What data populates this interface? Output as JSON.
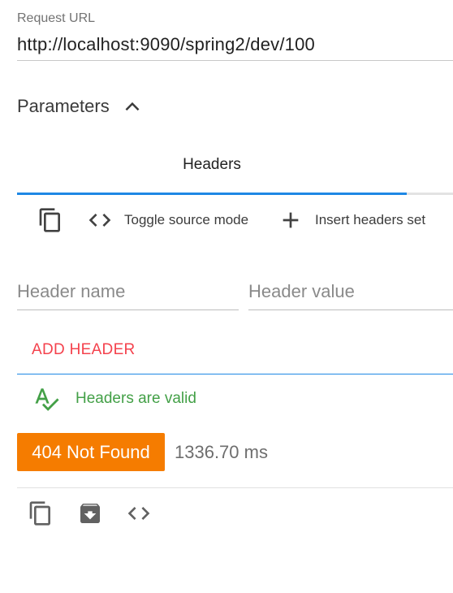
{
  "request": {
    "url_label": "Request URL",
    "url_value": "http://localhost:9090/spring2/dev/100"
  },
  "parameters": {
    "label": "Parameters",
    "icon": "chevron-up-icon"
  },
  "tabs": [
    {
      "label": "Headers",
      "selected": true
    }
  ],
  "toolbar": {
    "copy_icon": "copy-icon",
    "toggle_source_label": "Toggle source mode",
    "toggle_source_icon": "code-icon",
    "insert_set_label": "Insert headers set",
    "insert_set_icon": "plus-icon"
  },
  "headers_form": {
    "name_placeholder": "Header name",
    "value_placeholder": "Header value",
    "name_value": "",
    "value_value": "",
    "add_label": "ADD HEADER"
  },
  "validation": {
    "icon": "spellcheck-icon",
    "text": "Headers are valid"
  },
  "response": {
    "status_text": "404 Not Found",
    "time_text": "1336.70 ms"
  },
  "bottom_actions": {
    "copy_icon": "copy-icon",
    "archive_icon": "archive-download-icon",
    "code_icon": "code-icon"
  },
  "colors": {
    "accent": "#1e88e5",
    "add_header": "#f4424d",
    "valid": "#43a047",
    "status_badge": "#f57c00"
  }
}
